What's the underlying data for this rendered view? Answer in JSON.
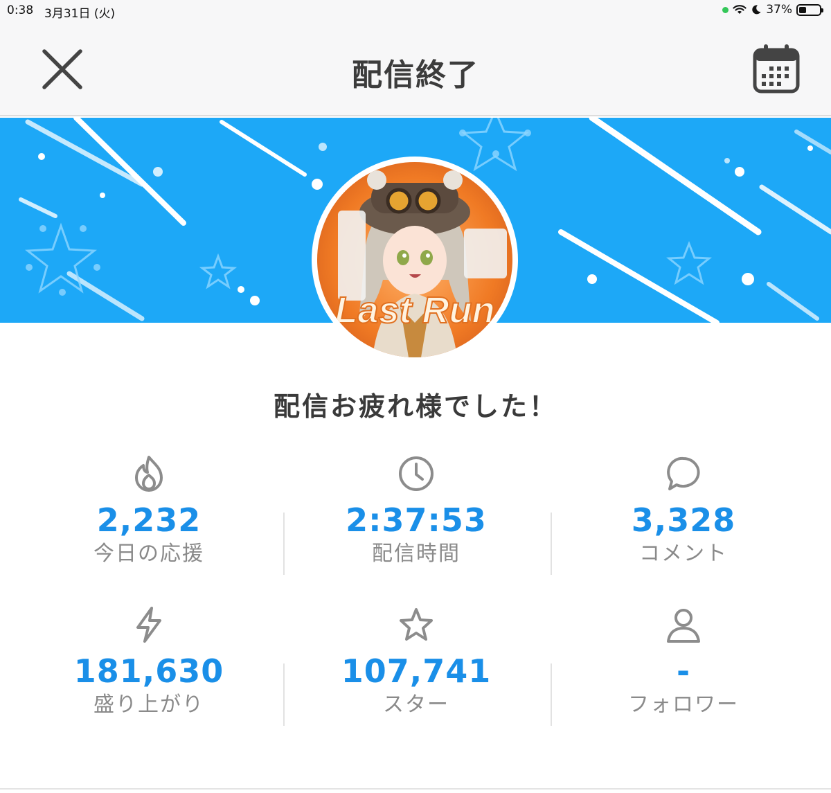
{
  "status_bar": {
    "time": "0:38",
    "date": "3月31日 (火)",
    "battery": "37%"
  },
  "header": {
    "title": "配信終了"
  },
  "banner": {
    "color": "#1da8f7",
    "avatar_text": "Last Run"
  },
  "message": "配信お疲れ様でした！",
  "stats": [
    {
      "icon": "flame-icon",
      "value": "2,232",
      "label": "今日の応援"
    },
    {
      "icon": "clock-icon",
      "value": "2:37:53",
      "label": "配信時間"
    },
    {
      "icon": "comment-icon",
      "value": "3,328",
      "label": "コメント"
    },
    {
      "icon": "lightning-icon",
      "value": "181,630",
      "label": "盛り上がり"
    },
    {
      "icon": "star-icon",
      "value": "107,741",
      "label": "スター"
    },
    {
      "icon": "person-icon",
      "value": "-",
      "label": "フォロワー"
    }
  ],
  "colors": {
    "accent": "#1a8fe8",
    "label": "#8a8a8a",
    "icon": "#8c8c8c"
  }
}
